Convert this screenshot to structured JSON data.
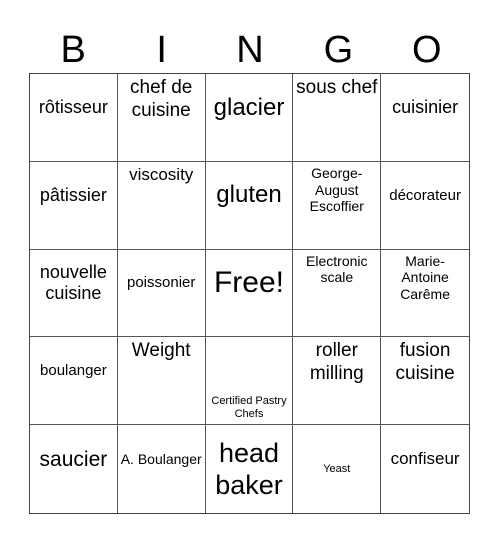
{
  "header": [
    "B",
    "I",
    "N",
    "G",
    "O"
  ],
  "cells": [
    {
      "text": "rôtisseur",
      "size": 18,
      "valign": "v-mid-up"
    },
    {
      "text": "chef de cuisine",
      "size": 19,
      "valign": "v-top"
    },
    {
      "text": "glacier",
      "size": 24,
      "valign": "v-mid-up"
    },
    {
      "text": "sous chef",
      "size": 19,
      "valign": "v-top"
    },
    {
      "text": "cuisinier",
      "size": 18,
      "valign": "v-mid-up"
    },
    {
      "text": "pâtissier",
      "size": 18,
      "valign": "v-mid-up"
    },
    {
      "text": "viscosity",
      "size": 17,
      "valign": "v-top"
    },
    {
      "text": "gluten",
      "size": 24,
      "valign": "v-mid-up"
    },
    {
      "text": "George-August Escoffier",
      "size": 14,
      "valign": "v-top"
    },
    {
      "text": "décorateur",
      "size": 15,
      "valign": "v-mid-up"
    },
    {
      "text": "nouvelle cuisine",
      "size": 18,
      "valign": "v-mid-up"
    },
    {
      "text": "poissonier",
      "size": 15,
      "valign": "v-mid-up"
    },
    {
      "text": "Free!",
      "size": 30,
      "valign": "v-mid-up"
    },
    {
      "text": "Electronic scale",
      "size": 14,
      "valign": "v-top"
    },
    {
      "text": "Marie-Antoine Carême",
      "size": 14,
      "valign": "v-top"
    },
    {
      "text": "boulanger",
      "size": 15,
      "valign": "v-mid-up"
    },
    {
      "text": "Weight",
      "size": 19,
      "valign": "v-top"
    },
    {
      "text": "Certified Pastry Chefs",
      "size": 11,
      "valign": "v-bot"
    },
    {
      "text": "roller milling",
      "size": 19,
      "valign": "v-top"
    },
    {
      "text": "fusion cuisine",
      "size": 19,
      "valign": "v-top"
    },
    {
      "text": "saucier",
      "size": 21,
      "valign": "v-mid-up"
    },
    {
      "text": "A. Boulanger",
      "size": 14,
      "valign": "v-mid-up"
    },
    {
      "text": "head baker",
      "size": 27,
      "valign": "v-mid"
    },
    {
      "text": "Yeast",
      "size": 11,
      "valign": "v-mid"
    },
    {
      "text": "confiseur",
      "size": 17,
      "valign": "v-mid-up"
    }
  ]
}
